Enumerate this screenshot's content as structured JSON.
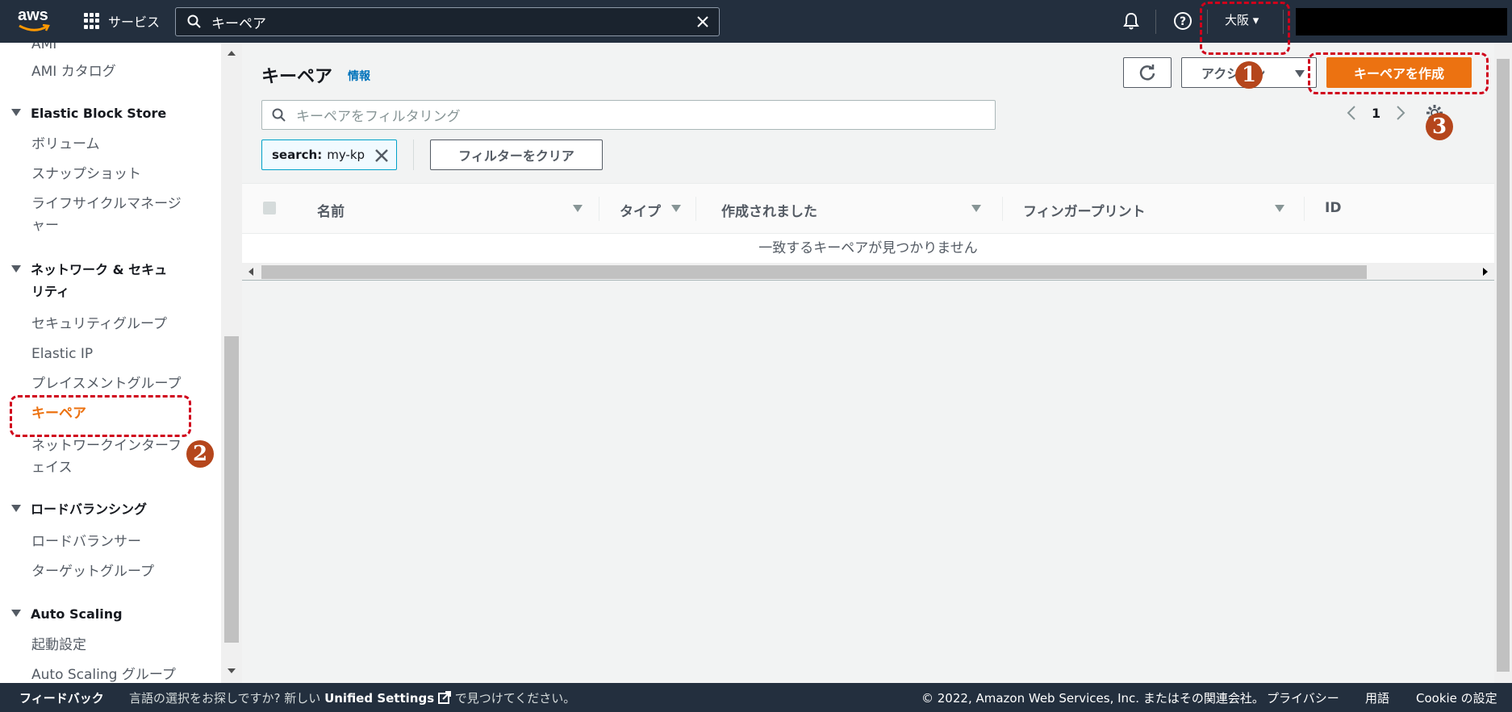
{
  "topnav": {
    "logo": "aws",
    "services_label": "サービス",
    "search_value": "キーペア",
    "region": "大阪 ▾"
  },
  "sidebar": {
    "items": [
      {
        "label": "AMI",
        "type": "item"
      },
      {
        "label": "AMI カタログ",
        "type": "item"
      },
      {
        "label": "Elastic Block Store",
        "type": "head"
      },
      {
        "label": "ボリューム",
        "type": "item"
      },
      {
        "label": "スナップショット",
        "type": "item"
      },
      {
        "label": "ライフサイクルマネージ",
        "type": "item"
      },
      {
        "label": "ャー",
        "type": "item"
      },
      {
        "label": "ネットワーク & セキュ",
        "type": "head"
      },
      {
        "label": "リティ",
        "type": "head"
      },
      {
        "label": "セキュリティグループ",
        "type": "item"
      },
      {
        "label": "Elastic IP",
        "type": "item"
      },
      {
        "label": "プレイスメントグループ",
        "type": "item"
      },
      {
        "label": "キーペア",
        "type": "active"
      },
      {
        "label": "ネットワークインターフ",
        "type": "item"
      },
      {
        "label": "ェイス",
        "type": "item"
      },
      {
        "label": "ロードバランシング",
        "type": "head"
      },
      {
        "label": "ロードバランサー",
        "type": "item"
      },
      {
        "label": "ターゲットグループ",
        "type": "item"
      },
      {
        "label": "Auto Scaling",
        "type": "head"
      },
      {
        "label": "起動設定",
        "type": "item"
      },
      {
        "label": "Auto Scaling グループ",
        "type": "item"
      }
    ]
  },
  "main": {
    "title": "キーペア",
    "info": "情報",
    "actions_label": "アクション",
    "create_label": "キーペアを作成",
    "filter_placeholder": "キーペアをフィルタリング",
    "page_number": "1",
    "chip_key": "search:",
    "chip_value": "my-kp",
    "clear_filter_label": "フィルターをクリア",
    "columns": [
      "名前",
      "タイプ",
      "作成されました",
      "フィンガープリント",
      "ID"
    ],
    "empty_message": "一致するキーペアが見つかりません"
  },
  "footer": {
    "feedback": "フィードバック",
    "lang_prefix": "言語の選択をお探しですか? 新しい",
    "lang_link": "Unified Settings",
    "lang_suffix": "で見つけてください。",
    "copyright": "© 2022, Amazon Web Services, Inc. またはその関連会社。",
    "privacy": "プライバシー",
    "terms": "用語",
    "cookie": "Cookie の設定"
  },
  "annotations": {
    "badge1": "1",
    "badge2": "2",
    "badge3": "3"
  },
  "colors": {
    "nav_bg": "#232f3e",
    "accent_orange": "#ec7211",
    "annotation_red": "#d0021b",
    "badge_brown": "#b5461c"
  }
}
